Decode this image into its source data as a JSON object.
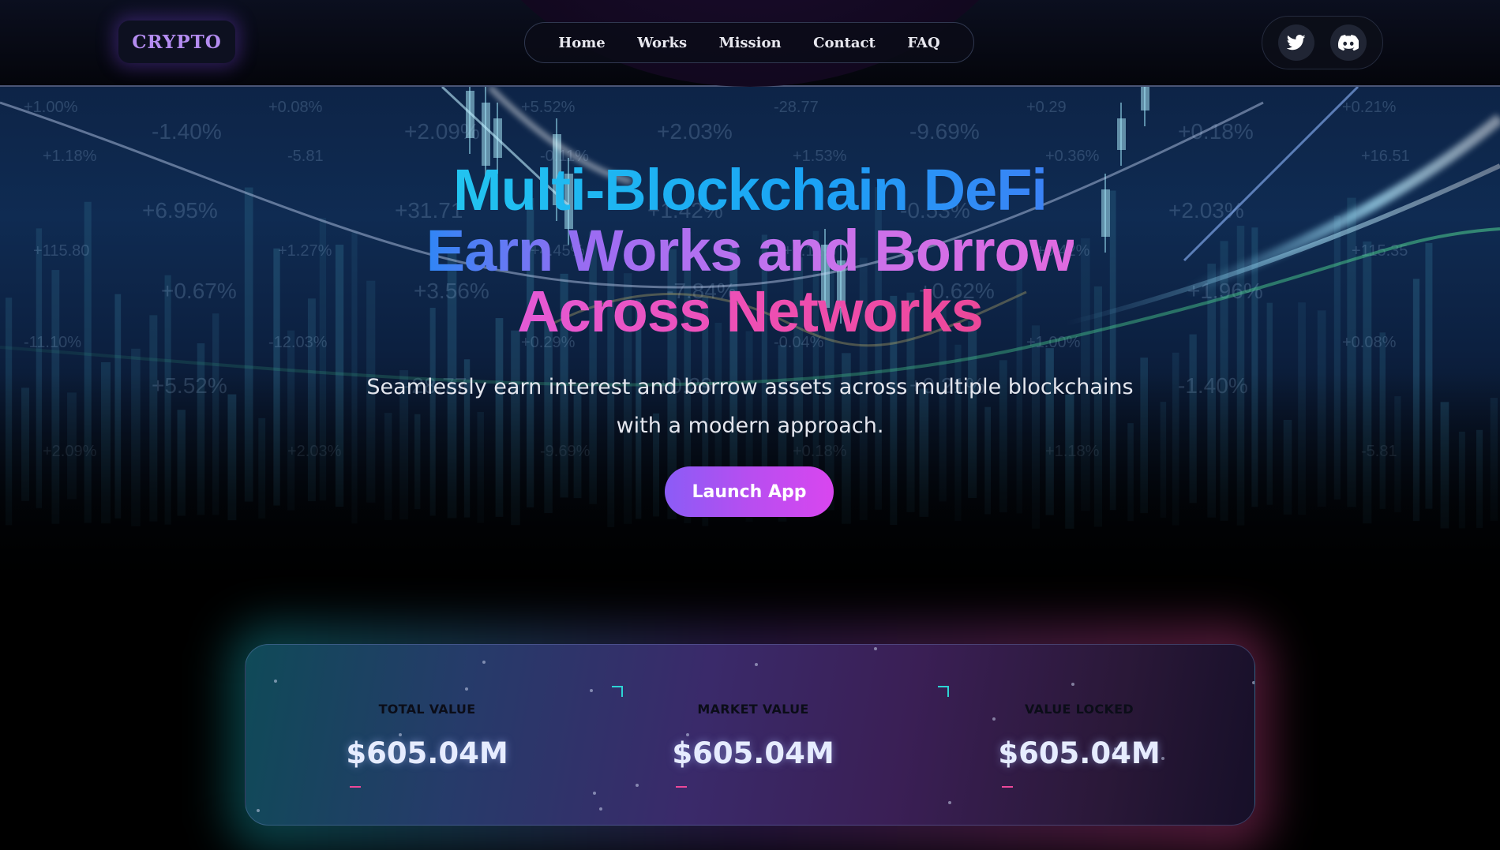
{
  "header": {
    "logo": "CRYPTO",
    "nav": [
      "Home",
      "Works",
      "Mission",
      "Contact",
      "FAQ"
    ],
    "social": [
      {
        "icon": "twitter-icon"
      },
      {
        "icon": "discord-icon"
      }
    ]
  },
  "hero": {
    "headline": {
      "line1": "Multi-Blockchain DeFi",
      "line2": "Earn Works and Borrow",
      "line3": "Across Networks"
    },
    "subtitle": "Seamlessly earn interest and borrow assets across multiple blockchains with a modern approach.",
    "cta": "Launch App",
    "ticker_texts": [
      "+1.00%",
      "+0.08%",
      "+5.52%",
      "-28.77",
      "+0.29",
      "+0.21%",
      "-1.40%",
      "+2.09%",
      "+2.03%",
      "-9.69%",
      "+0.18%",
      "+1.18%",
      "-5.81",
      "-0.11%",
      "+1.53%",
      "+0.36%",
      "+16.51",
      "+6.95%",
      "+31.71",
      "+1.42%",
      "-0.53%",
      "+2.03%",
      "+115.80",
      "+1.27%",
      "+4.45%",
      "+1.11%",
      "+8.42%",
      "+115.35",
      "+0.67%",
      "+3.56%",
      "-7.84%",
      "+0.62%",
      "+1.96%",
      "-11.10%",
      "-12.03%",
      "+0.29%",
      "-0.04%"
    ]
  },
  "stats": [
    {
      "label": "TOTAL VALUE",
      "value": "$605.04M"
    },
    {
      "label": "MARKET VALUE",
      "value": "$605.04M"
    },
    {
      "label": "VALUE LOCKED",
      "value": "$605.04M"
    }
  ],
  "colors": {
    "accent_purple": "#8b5cf6",
    "accent_pink": "#ec4899",
    "accent_cyan": "#22c4f0",
    "background": "#000000"
  }
}
